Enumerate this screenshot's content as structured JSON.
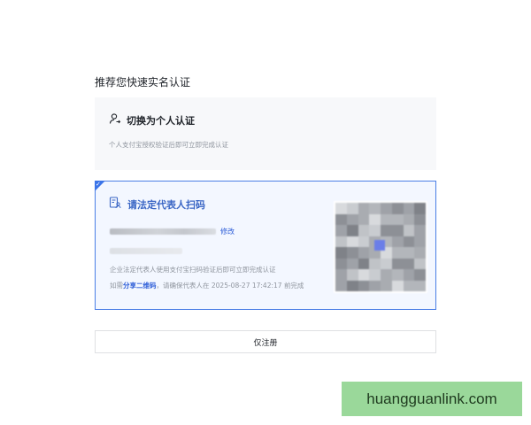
{
  "heading": "推荐您快速实名认证",
  "personal": {
    "title": "切换为个人认证",
    "description": "个人支付宝授权验证后即可立即完成认证",
    "icon": "person-switch-icon"
  },
  "legal": {
    "title": "请法定代表人扫码",
    "icon": "document-person-icon",
    "edit_label": "修改",
    "description": "企业法定代表人使用支付宝扫码验证后即可立即完成认证",
    "deadline_prefix": "如需",
    "share_label": "分享二维码",
    "deadline_mid": "，请确保代表人在",
    "deadline_time": "2025-08-27 17:42:17",
    "deadline_suffix": "前完成",
    "accent_color": "#3b74e8",
    "selected_corner_icon": "check-icon",
    "qr_icon": "qr-code-icon"
  },
  "register_button": "仅注册",
  "watermark": "huangguanlink.com"
}
